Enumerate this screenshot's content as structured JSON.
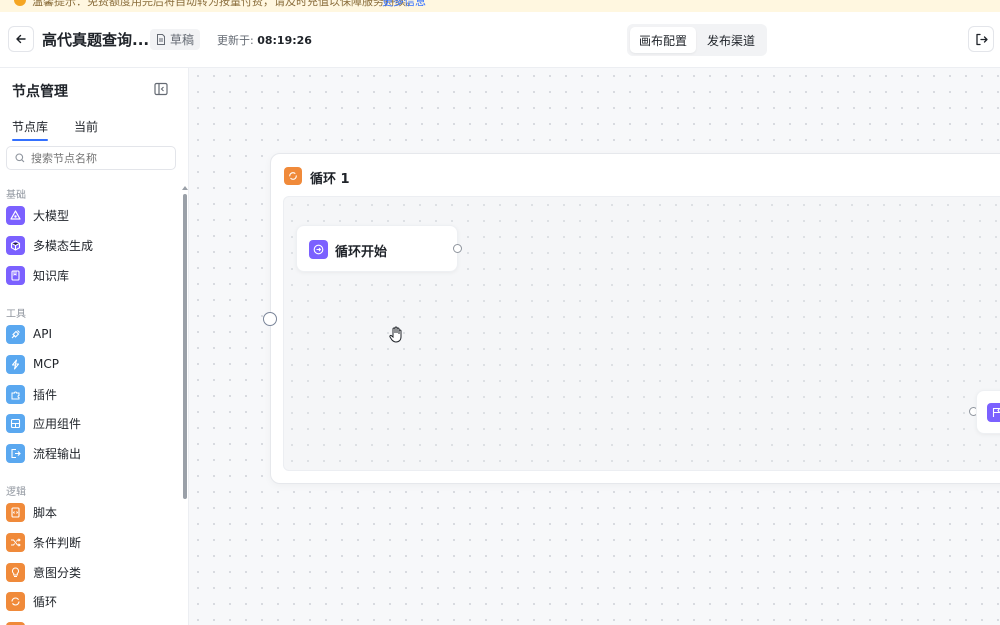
{
  "warning": {
    "text": "温馨提示：免费额度用完后将自动转为按量付费，请及时充值以保障服务持续。",
    "link": "更多信息"
  },
  "header": {
    "title": "高代真题查询...",
    "draft_label": "草稿",
    "updated_label": "更新于:",
    "updated_time": "08:19:26",
    "tabs": [
      "画布配置",
      "发布渠道"
    ],
    "active_tab": "画布配置"
  },
  "sidebar": {
    "title": "节点管理",
    "tabs": [
      "节点库",
      "当前"
    ],
    "search_placeholder": "搜索节点名称",
    "groups": [
      {
        "title": "基础",
        "items": [
          {
            "label": "大模型",
            "icon": "llm-icon",
            "color": "#7b61ff"
          },
          {
            "label": "多模态生成",
            "icon": "multimodal-icon",
            "color": "#7b61ff"
          },
          {
            "label": "知识库",
            "icon": "knowledge-icon",
            "color": "#7b61ff"
          }
        ]
      },
      {
        "title": "工具",
        "items": [
          {
            "label": "API",
            "icon": "api-icon",
            "color": "#5aa8f0"
          },
          {
            "label": "MCP",
            "icon": "mcp-icon",
            "color": "#5aa8f0"
          },
          {
            "label": "插件",
            "icon": "plugin-icon",
            "color": "#5aa8f0"
          },
          {
            "label": "应用组件",
            "icon": "component-icon",
            "color": "#5aa8f0"
          },
          {
            "label": "流程输出",
            "icon": "output-icon",
            "color": "#5aa8f0"
          }
        ]
      },
      {
        "title": "逻辑",
        "items": [
          {
            "label": "脚本",
            "icon": "script-icon",
            "color": "#f08a3a"
          },
          {
            "label": "条件判断",
            "icon": "condition-icon",
            "color": "#f08a3a"
          },
          {
            "label": "意图分类",
            "icon": "intent-icon",
            "color": "#f08a3a"
          },
          {
            "label": "循环",
            "icon": "loop-icon",
            "color": "#f08a3a"
          }
        ]
      }
    ]
  },
  "canvas": {
    "loop_title": "循环 1",
    "start_title": "循环开始"
  }
}
